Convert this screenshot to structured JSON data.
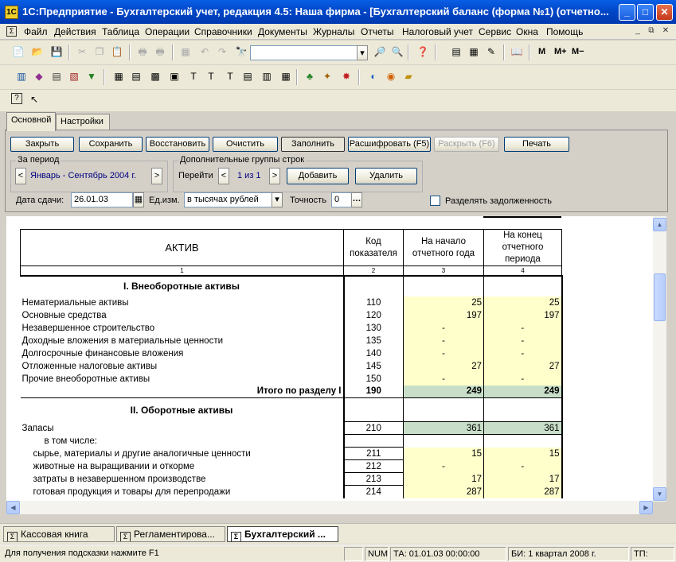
{
  "window": {
    "title": "1С:Предприятие - Бухгалтерский учет, редакция 4.5: Наша фирма - [Бухгалтерский баланс (форма №1) (отчетно...",
    "app_icon": "1С",
    "minimize": "_",
    "maximize": "□",
    "close": "✕"
  },
  "menu": {
    "items": [
      "Файл",
      "Действия",
      "Таблица",
      "Операции",
      "Справочники",
      "Документы",
      "Журналы",
      "Отчеты",
      "Налоговый учет",
      "Сервис",
      "Окна",
      "Помощь"
    ],
    "calc_buttons": [
      "M",
      "M+",
      "M−"
    ]
  },
  "tabs": [
    "Основной",
    "Настройки"
  ],
  "buttons": {
    "close": "Закрыть",
    "save": "Сохранить",
    "restore": "Восстановить",
    "clear": "Очистить",
    "fill": "Заполнить",
    "decode": "Расшифровать (F5)",
    "expand": "Раскрыть (F6)",
    "print": "Печать",
    "add": "Добавить",
    "delete": "Удалить"
  },
  "period": {
    "label": "За период",
    "value": "Январь - Сентябрь 2004 г.",
    "prev": "<",
    "next": ">"
  },
  "extra_groups": {
    "label": "Дополнительные группы строк",
    "goto_label": "Перейти",
    "counter": "1 из 1",
    "prev": "<",
    "next": ">"
  },
  "form": {
    "date_label": "Дата сдачи:",
    "date_value": "26.01.03",
    "unit_label": "Ед.изм.",
    "unit_value": "в тысячах рублей",
    "precision_label": "Точность",
    "precision_value": "0",
    "split_debt_label": "Разделять задолженность",
    "split_debt_checked": false
  },
  "sheet": {
    "header": {
      "asset": "АКТИВ",
      "code": "Код показателя",
      "start": "На начало отчетного года",
      "end": "На конец отчетного периода",
      "n1": "1",
      "n2": "2",
      "n3": "3",
      "n4": "4"
    },
    "section1": {
      "title": "I. Внеоборотные активы",
      "rows": [
        {
          "name": "Нематериальные активы",
          "code": "110",
          "start": "25",
          "end": "25"
        },
        {
          "name": "Основные средства",
          "code": "120",
          "start": "197",
          "end": "197"
        },
        {
          "name": "Незавершенное строительство",
          "code": "130",
          "start": "-",
          "end": "-"
        },
        {
          "name": "Доходные вложения в материальные ценности",
          "code": "135",
          "start": "-",
          "end": "-"
        },
        {
          "name": "Долгосрочные финансовые вложения",
          "code": "140",
          "start": "-",
          "end": "-"
        },
        {
          "name": "Отложенные налоговые активы",
          "code": "145",
          "start": "27",
          "end": "27"
        },
        {
          "name": "Прочие внеоборотные активы",
          "code": "150",
          "start": "-",
          "end": "-"
        }
      ],
      "total": {
        "name": "Итого по разделу I",
        "code": "190",
        "start": "249",
        "end": "249"
      }
    },
    "section2": {
      "title": "II. Оборотные активы",
      "stocks": {
        "name": "Запасы",
        "code": "210",
        "start": "361",
        "end": "361"
      },
      "including": "в том числе:",
      "rows": [
        {
          "name": "сырье, материалы и другие аналогичные ценности",
          "code": "211",
          "start": "15",
          "end": "15"
        },
        {
          "name": "животные на выращивании и откорме",
          "code": "212",
          "start": "-",
          "end": "-"
        },
        {
          "name": "затраты в незавершенном производстве",
          "code": "213",
          "start": "17",
          "end": "17"
        },
        {
          "name": "готовая продукция и товары для перепродажи",
          "code": "214",
          "start": "287",
          "end": "287"
        }
      ]
    }
  },
  "taskbar": [
    {
      "label": "Кассовая книга"
    },
    {
      "label": "Регламентирова..."
    },
    {
      "label": "Бухгалтерский ..."
    }
  ],
  "status": {
    "hint": "Для получения подсказки нажмите F1",
    "num": "NUM",
    "ta": "ТА: 01.01.03  00:00:00",
    "bi": "БИ: 1 квартал 2008 г.",
    "tp": "ТП:"
  },
  "colors": {
    "title_bar": "#0a5fe6",
    "input_cell": "#ffffcc",
    "total_cell": "#c8dec8"
  }
}
